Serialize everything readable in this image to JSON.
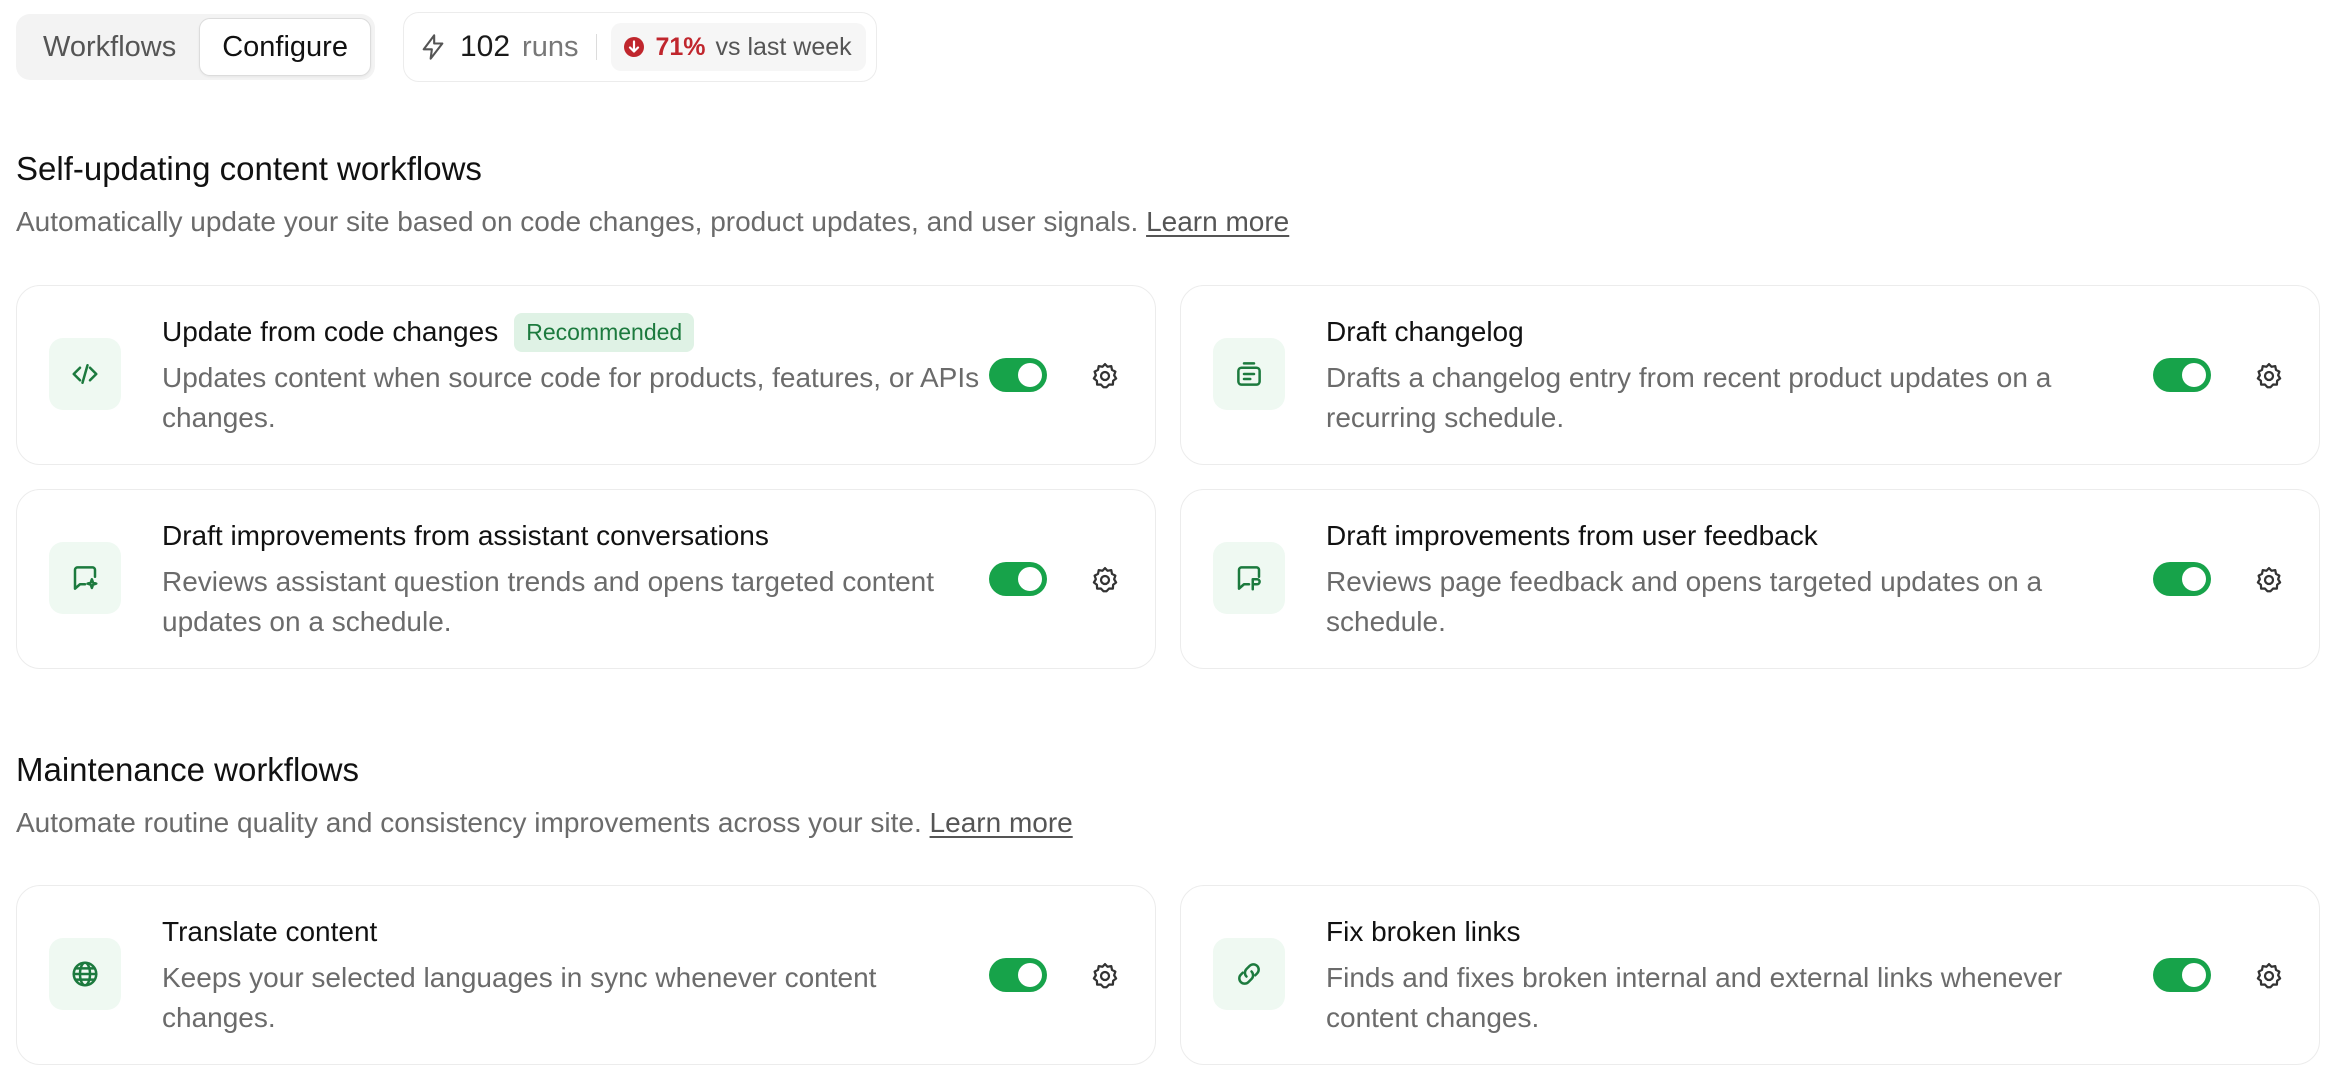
{
  "tabs": [
    {
      "label": "Workflows",
      "active": false
    },
    {
      "label": "Configure",
      "active": true
    }
  ],
  "stats": {
    "icon": "bolt-icon",
    "runs_count": "102",
    "runs_label": "runs",
    "trend_icon": "arrow-down-circle-icon",
    "trend_value": "71%",
    "trend_label": "vs last week",
    "trend_color": "#c0262d"
  },
  "sections": [
    {
      "title": "Self-updating content workflows",
      "description": "Automatically update your site based on code changes, product updates, and user signals.",
      "link": "Learn more",
      "cards": [
        {
          "icon": "code-icon",
          "title": "Update from code changes",
          "badge": "Recommended",
          "description": "Updates content when source code for products, features, or APIs changes.",
          "enabled": true
        },
        {
          "icon": "changelog-icon",
          "title": "Draft changelog",
          "badge": "",
          "description": "Drafts a changelog entry from recent product updates on a recurring schedule.",
          "enabled": true
        },
        {
          "icon": "chat-sparkle-icon",
          "title": "Draft improvements from assistant conversations",
          "badge": "",
          "description": "Reviews assistant question trends and opens targeted content updates on a schedule.",
          "enabled": true
        },
        {
          "icon": "feedback-icon",
          "title": "Draft improvements from user feedback",
          "badge": "",
          "description": "Reviews page feedback and opens targeted updates on a schedule.",
          "enabled": true
        }
      ]
    },
    {
      "title": "Maintenance workflows",
      "description": "Automate routine quality and consistency improvements across your site.",
      "link": "Learn more",
      "cards": [
        {
          "icon": "globe-icon",
          "title": "Translate content",
          "badge": "",
          "description": "Keeps your selected languages in sync whenever content changes.",
          "enabled": true
        },
        {
          "icon": "link-icon",
          "title": "Fix broken links",
          "badge": "",
          "description": "Finds and fixes broken internal and external links whenever content changes.",
          "enabled": true
        }
      ]
    }
  ],
  "colors": {
    "accent_green": "#17a34a",
    "icon_green": "#1c7a3e",
    "icon_bg": "#eff9f2",
    "badge_bg": "#dff2e5"
  }
}
